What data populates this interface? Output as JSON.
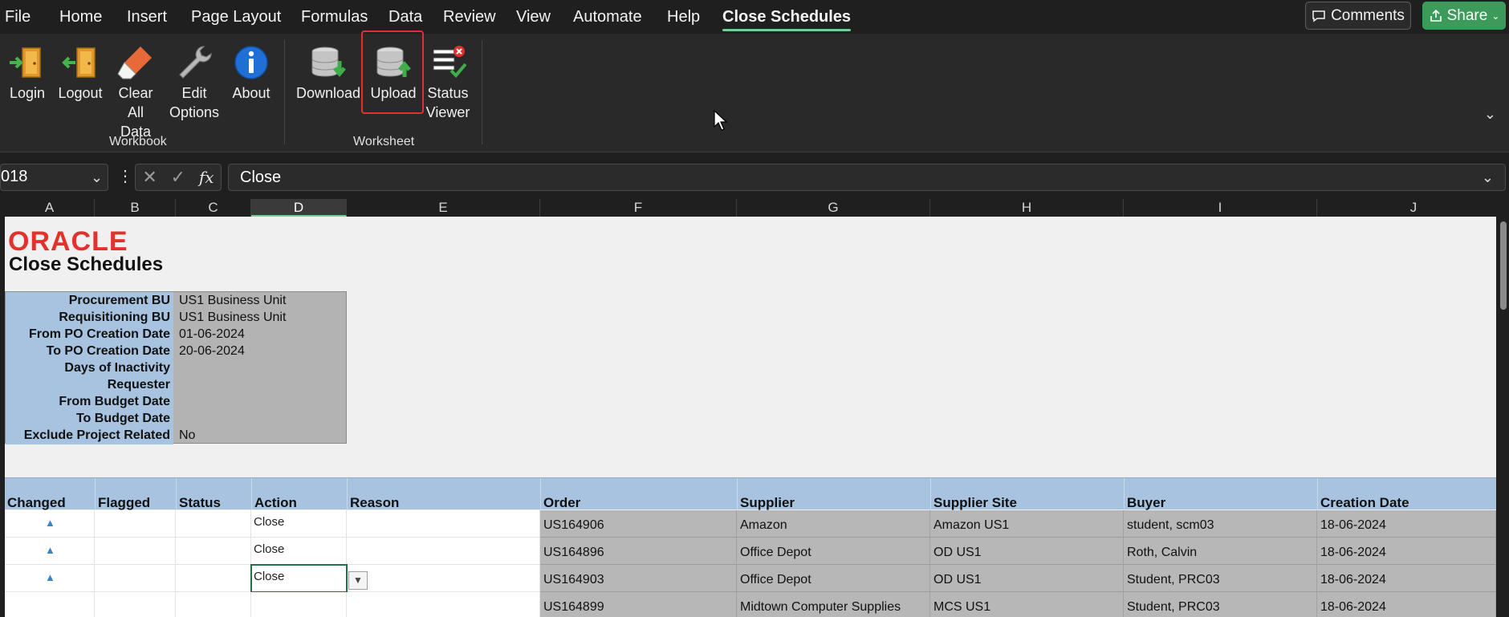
{
  "menu": {
    "items": [
      "File",
      "Home",
      "Insert",
      "Page Layout",
      "Formulas",
      "Data",
      "Review",
      "View",
      "Automate",
      "Help",
      "Close Schedules"
    ],
    "comments_label": "Comments",
    "share_label": "Share"
  },
  "ribbon": {
    "workbook_group": "Workbook",
    "worksheet_group": "Worksheet",
    "login": "Login",
    "logout": "Logout",
    "clear_1": "Clear",
    "clear_2": "All Data",
    "edit_1": "Edit",
    "edit_2": "Options",
    "about": "About",
    "download": "Download",
    "upload": "Upload",
    "status_1": "Status",
    "status_2": "Viewer"
  },
  "formula_bar": {
    "name_box": "018",
    "formula": "Close"
  },
  "columns": [
    "A",
    "B",
    "C",
    "D",
    "E",
    "F",
    "G",
    "H",
    "I",
    "J"
  ],
  "sheet": {
    "logo": "ORACLE",
    "title": "Close Schedules",
    "params": [
      {
        "label": "Procurement BU",
        "value": "US1 Business Unit"
      },
      {
        "label": "Requisitioning BU",
        "value": "US1 Business Unit"
      },
      {
        "label": "From PO Creation Date",
        "value": "01-06-2024"
      },
      {
        "label": "To PO Creation Date",
        "value": "20-06-2024"
      },
      {
        "label": "Days of Inactivity",
        "value": ""
      },
      {
        "label": "Requester",
        "value": ""
      },
      {
        "label": "From Budget Date",
        "value": ""
      },
      {
        "label": "To Budget Date",
        "value": ""
      },
      {
        "label": "Exclude Project Related",
        "value": "No"
      }
    ],
    "headers": [
      "Changed",
      "Flagged",
      "Status",
      "Action",
      "Reason",
      "Order",
      "Supplier",
      "Supplier Site",
      "Buyer",
      "Creation Date"
    ],
    "rows": [
      {
        "changed": "▲",
        "action": "Close",
        "order": "US164906",
        "supplier": "Amazon",
        "site": "Amazon US1",
        "buyer": "student, scm03",
        "date": "18-06-2024"
      },
      {
        "changed": "▲",
        "action": "Close",
        "order": "US164896",
        "supplier": "Office Depot",
        "site": "OD US1",
        "buyer": "Roth, Calvin",
        "date": "18-06-2024"
      },
      {
        "changed": "▲",
        "action": "Close",
        "order": "US164903",
        "supplier": "Office Depot",
        "site": "OD US1",
        "buyer": "Student, PRC03",
        "date": "18-06-2024"
      },
      {
        "changed": "",
        "action": "",
        "order": "US164899",
        "supplier": "Midtown Computer Supplies",
        "site": "MCS US1",
        "buyer": "Student, PRC03",
        "date": "18-06-2024"
      }
    ]
  },
  "colors": {
    "accent": "#6fcf97",
    "share": "#3c9a5b",
    "highlight": "#e0312c",
    "oracle_red": "#e3322b",
    "header_blue": "#a7c3e0"
  }
}
